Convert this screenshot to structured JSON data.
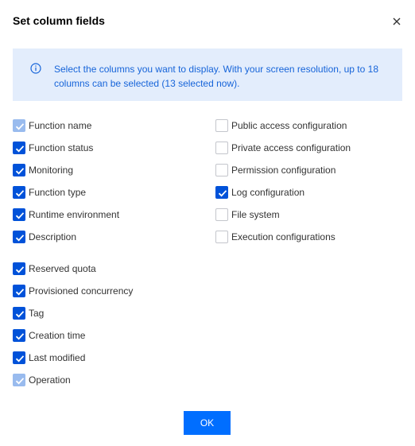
{
  "dialog": {
    "title": "Set column fields",
    "close_icon": "close-icon",
    "info_icon": "info-circle-icon",
    "info_text": "Select the columns you want to display. With your screen resolution, up to 18 columns can be selected (13 selected now).",
    "ok_label": "OK"
  },
  "colors": {
    "checked": "#0052d9",
    "disabled_checked": "#99bbee",
    "banner_bg": "#e3edfc",
    "banner_text": "#1664d9",
    "primary_button": "#006eff"
  },
  "options": {
    "function_name": {
      "label": "Function name",
      "checked": true,
      "disabled": true
    },
    "function_status": {
      "label": "Function status",
      "checked": true,
      "disabled": false
    },
    "monitoring": {
      "label": "Monitoring",
      "checked": true,
      "disabled": false
    },
    "function_type": {
      "label": "Function type",
      "checked": true,
      "disabled": false
    },
    "runtime_environment": {
      "label": "Runtime environment",
      "checked": true,
      "disabled": false
    },
    "description": {
      "label": "Description",
      "checked": true,
      "disabled": false
    },
    "public_access": {
      "label": "Public access configuration",
      "checked": false,
      "disabled": false
    },
    "private_access": {
      "label": "Private access configuration",
      "checked": false,
      "disabled": false
    },
    "permission": {
      "label": "Permission configuration",
      "checked": false,
      "disabled": false
    },
    "log_configuration": {
      "label": "Log configuration",
      "checked": true,
      "disabled": false
    },
    "file_system": {
      "label": "File system",
      "checked": false,
      "disabled": false
    },
    "execution_configurations": {
      "label": "Execution configurations",
      "checked": false,
      "disabled": false
    },
    "reserved_quota": {
      "label": "Reserved quota",
      "checked": true,
      "disabled": false
    },
    "provisioned_concurrency": {
      "label": "Provisioned concurrency",
      "checked": true,
      "disabled": false
    },
    "tag": {
      "label": "Tag",
      "checked": true,
      "disabled": false
    },
    "creation_time": {
      "label": "Creation time",
      "checked": true,
      "disabled": false
    },
    "last_modified": {
      "label": "Last modified",
      "checked": true,
      "disabled": false
    },
    "operation": {
      "label": "Operation",
      "checked": true,
      "disabled": true
    }
  }
}
